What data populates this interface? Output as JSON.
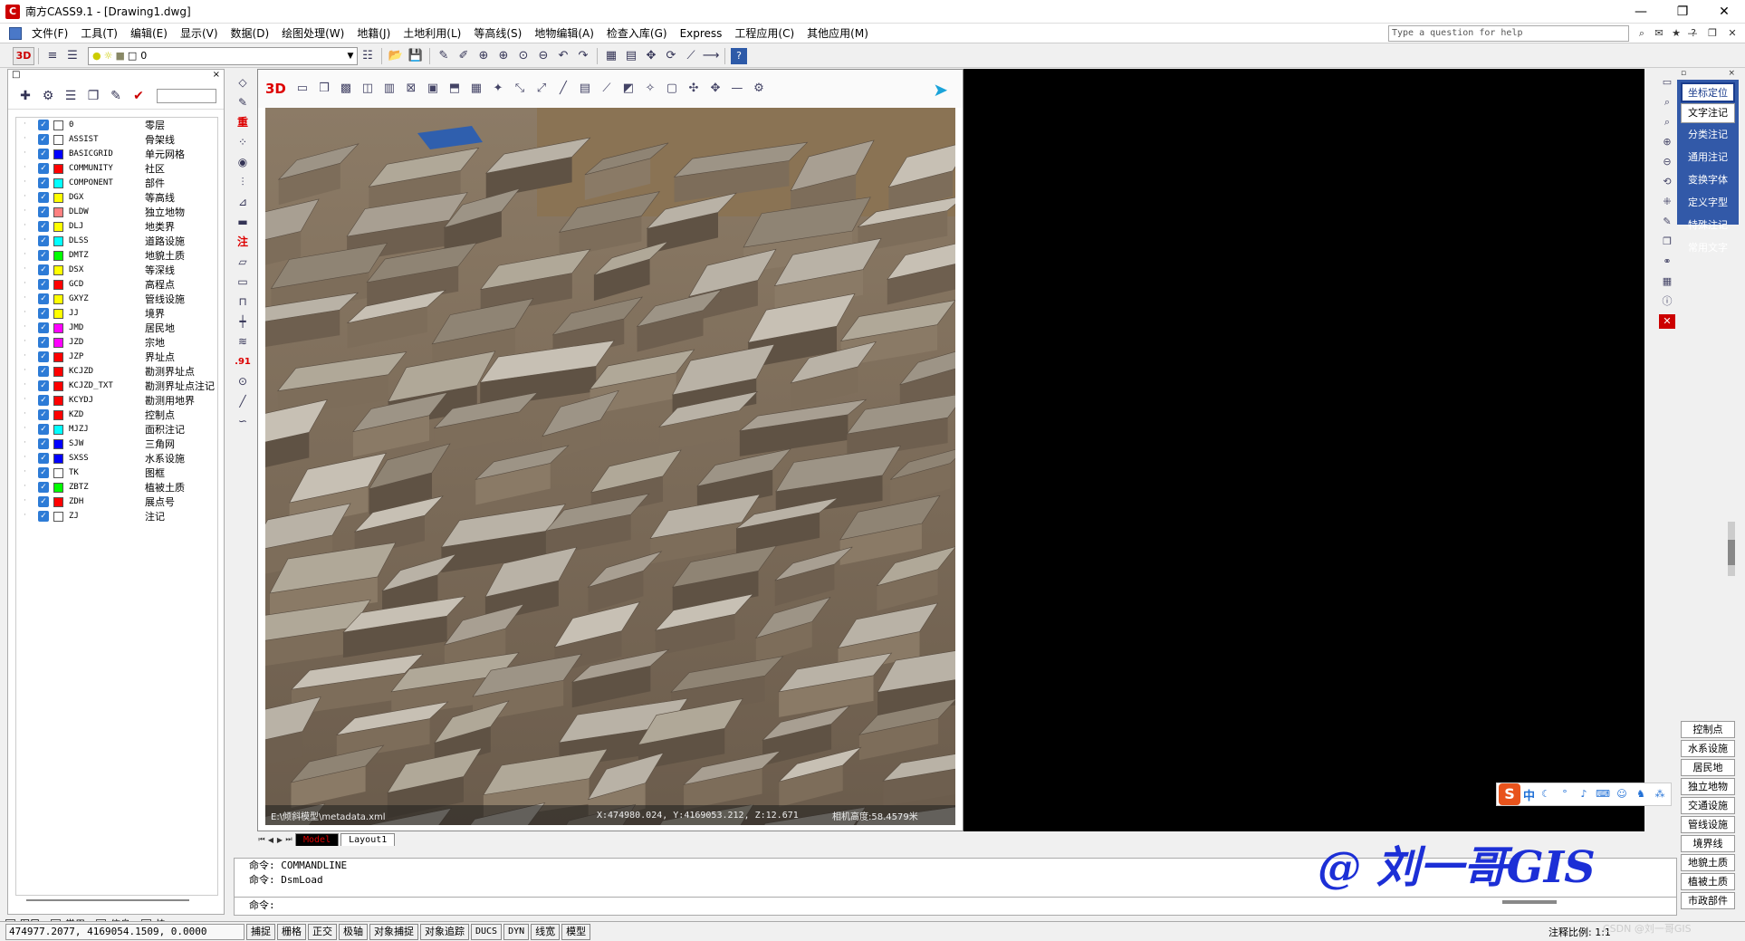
{
  "window": {
    "title": "南方CASS9.1 - [Drawing1.dwg]",
    "app_icon": "C",
    "minimize": "—",
    "restore": "❐",
    "close": "✕"
  },
  "menu": {
    "items": [
      "文件(F)",
      "工具(T)",
      "编辑(E)",
      "显示(V)",
      "数据(D)",
      "绘图处理(W)",
      "地籍(J)",
      "土地利用(L)",
      "等高线(S)",
      "地物编辑(A)",
      "检查入库(G)",
      "Express",
      "工程应用(C)",
      "其他应用(M)"
    ],
    "help_placeholder": "Type a question for help",
    "mdi_min": "—",
    "mdi_restore": "❐",
    "mdi_close": "✕"
  },
  "toolbar": {
    "btn_3d": "3D",
    "layer_value": "0"
  },
  "layers_panel": {
    "close": "×",
    "layers": [
      {
        "name": "0",
        "desc": "零层",
        "color": "#ffffff"
      },
      {
        "name": "ASSIST",
        "desc": "骨架线",
        "color": "#ffffff"
      },
      {
        "name": "BASICGRID",
        "desc": "单元网格",
        "color": "#0000ff"
      },
      {
        "name": "COMMUNITY",
        "desc": "社区",
        "color": "#ff0000"
      },
      {
        "name": "COMPONENT",
        "desc": "部件",
        "color": "#00ffff"
      },
      {
        "name": "DGX",
        "desc": "等高线",
        "color": "#ffff00"
      },
      {
        "name": "DLDW",
        "desc": "独立地物",
        "color": "#ff8080"
      },
      {
        "name": "DLJ",
        "desc": "地类界",
        "color": "#ffff00"
      },
      {
        "name": "DLSS",
        "desc": "道路设施",
        "color": "#00ffff"
      },
      {
        "name": "DMTZ",
        "desc": "地貌土质",
        "color": "#00ff00"
      },
      {
        "name": "DSX",
        "desc": "等深线",
        "color": "#ffff00"
      },
      {
        "name": "GCD",
        "desc": "高程点",
        "color": "#ff0000"
      },
      {
        "name": "GXYZ",
        "desc": "管线设施",
        "color": "#ffff00"
      },
      {
        "name": "JJ",
        "desc": "境界",
        "color": "#ffff00"
      },
      {
        "name": "JMD",
        "desc": "居民地",
        "color": "#ff00ff"
      },
      {
        "name": "JZD",
        "desc": "宗地",
        "color": "#ff00ff"
      },
      {
        "name": "JZP",
        "desc": "界址点",
        "color": "#ff0000"
      },
      {
        "name": "KCJZD",
        "desc": "勘测界址点",
        "color": "#ff0000"
      },
      {
        "name": "KCJZD_TXT",
        "desc": "勘测界址点注记",
        "color": "#ff0000"
      },
      {
        "name": "KCYDJ",
        "desc": "勘测用地界",
        "color": "#ff0000"
      },
      {
        "name": "KZD",
        "desc": "控制点",
        "color": "#ff0000"
      },
      {
        "name": "MJZJ",
        "desc": "面积注记",
        "color": "#00ffff"
      },
      {
        "name": "SJW",
        "desc": "三角网",
        "color": "#0000ff"
      },
      {
        "name": "SXSS",
        "desc": "水系设施",
        "color": "#0000ff"
      },
      {
        "name": "TK",
        "desc": "图框",
        "color": "#ffffff"
      },
      {
        "name": "ZBTZ",
        "desc": "植被土质",
        "color": "#00ff00"
      },
      {
        "name": "ZDH",
        "desc": "展点号",
        "color": "#ff0000"
      },
      {
        "name": "ZJ",
        "desc": "注记",
        "color": "#ffffff"
      }
    ],
    "tabs": [
      "图层",
      "常用",
      "信息",
      "快"
    ]
  },
  "vertical_toolbar": {
    "zhong": "重",
    "zhu": "注",
    "dot91": ".91"
  },
  "viewport": {
    "title_3d": "3D",
    "status_path": "E:\\倾斜模型\\metadata.xml",
    "status_coords": "X:474980.024, Y:4169053.212, Z:12.671",
    "status_height": "相机高度:58.4579米"
  },
  "layout_tabs": [
    "Model",
    "Layout1"
  ],
  "command": {
    "lines": [
      "命令: COMMANDLINE",
      "命令: DsmLoad"
    ],
    "prompt": "命令:"
  },
  "annotation_panel": {
    "header_title": "",
    "top_items": [
      "坐标定位",
      "文字注记",
      "分类注记",
      "通用注记",
      "变换字体",
      "定义字型",
      "特殊注记",
      "常用文字"
    ],
    "bottom_items": [
      "控制点",
      "水系设施",
      "居民地",
      "独立地物",
      "交通设施",
      "管线设施",
      "境界线",
      "地貌土质",
      "植被土质",
      "市政部件"
    ]
  },
  "statusbar": {
    "coords": "474977.2077, 4169054.1509, 0.0000",
    "toggles": [
      "捕捉",
      "栅格",
      "正交",
      "极轴",
      "对象捕捉",
      "对象追踪",
      "DUCS",
      "DYN",
      "线宽",
      "模型"
    ],
    "scale_label": "注释比例:",
    "scale_value": "1:1"
  },
  "overlays": {
    "watermark": "@ 刘一哥GIS",
    "ime_logo": "S",
    "ime_lang": "中",
    "csdn": "CSDN @刘一哥GIS"
  }
}
